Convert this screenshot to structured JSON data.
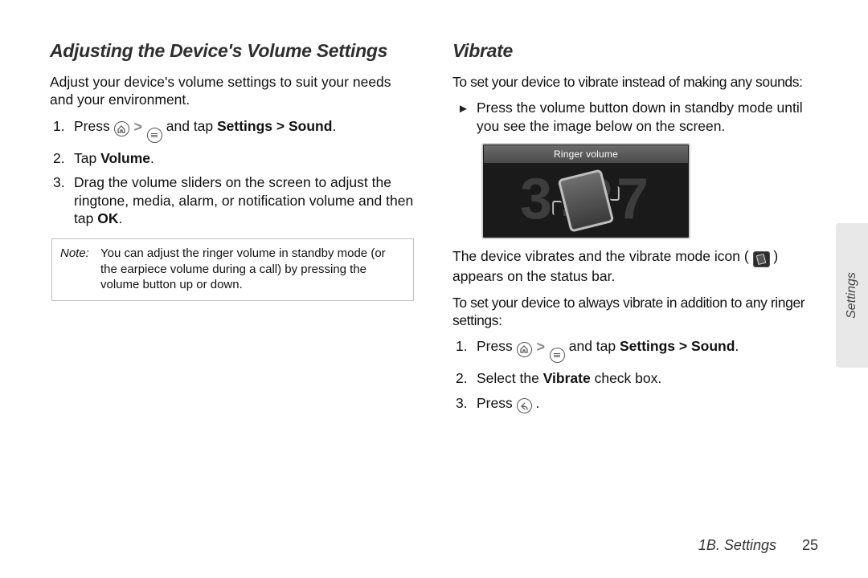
{
  "left": {
    "heading": "Adjusting the Device's Volume Settings",
    "intro": "Adjust your device's volume settings to suit your needs and your environment.",
    "step1": {
      "prefix": "Press ",
      "mid": " and tap ",
      "path": "Settings > Sound",
      "suffix": "."
    },
    "step2": {
      "prefix": "Tap ",
      "bold": "Volume",
      "suffix": "."
    },
    "step3": {
      "prefix": "Drag the volume sliders on the screen to adjust the ringtone, media, alarm, or notification volume and then tap ",
      "bold": "OK",
      "suffix": "."
    },
    "note": {
      "label": "Note:",
      "body": "You can adjust the ringer volume in standby mode (or the earpiece volume during a call) by pressing the volume button up or down."
    }
  },
  "right": {
    "heading": "Vibrate",
    "intro1": "To set your device to vibrate instead of making any sounds:",
    "bullet1": "Press the volume button down in standby mode until you see the image below on the screen.",
    "ringer_header": "Ringer volume",
    "clock_h": "3",
    "clock_m": "27",
    "after_img_a": "The device vibrates and the vibrate mode icon (",
    "after_img_b": ") appears on the status bar.",
    "intro2": "To set your device to always vibrate in addition to any ringer settings:",
    "step1": {
      "prefix": "Press ",
      "mid": " and tap ",
      "path": "Settings > Sound",
      "suffix": "."
    },
    "step2": {
      "prefix": "Select the ",
      "bold": "Vibrate",
      "suffix": " check box."
    },
    "step3": {
      "prefix": "Press ",
      "suffix": "."
    }
  },
  "side_tab": "Settings",
  "footer": {
    "section": "1B. Settings",
    "page": "25"
  }
}
